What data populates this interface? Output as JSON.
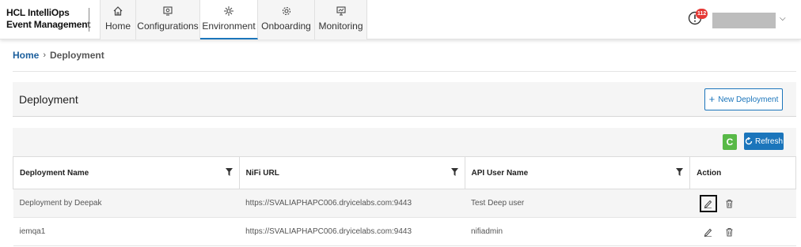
{
  "brand": {
    "line1": "HCL IntelliOps",
    "line2": "Event Management"
  },
  "nav": {
    "items": [
      {
        "label": "Home",
        "icon": "home-icon"
      },
      {
        "label": "Configurations",
        "icon": "config-icon"
      },
      {
        "label": "Environment",
        "icon": "environment-icon",
        "active": true
      },
      {
        "label": "Onboarding",
        "icon": "gear-icon"
      },
      {
        "label": "Monitoring",
        "icon": "monitor-icon"
      }
    ]
  },
  "header": {
    "alert_count": "112"
  },
  "breadcrumb": {
    "home": "Home",
    "separator": "›",
    "current": "Deployment"
  },
  "panel": {
    "title": "Deployment",
    "new_button": "New Deployment"
  },
  "toolbar": {
    "c_label": "C",
    "refresh_label": "Refresh"
  },
  "table": {
    "columns": [
      "Deployment Name",
      "NiFi URL",
      "API User Name",
      "Action"
    ],
    "rows": [
      {
        "name": "Deployment by Deepak",
        "url": "https://SVALIAPHAPC006.dryicelabs.com:9443",
        "user": "Test Deep user"
      },
      {
        "name": "iemqa1",
        "url": "https://SVALIAPHAPC006.dryicelabs.com:9443",
        "user": "nifiadmin"
      }
    ]
  },
  "colors": {
    "accent": "#1b75bb",
    "green": "#58b947",
    "badge": "#e53935"
  }
}
